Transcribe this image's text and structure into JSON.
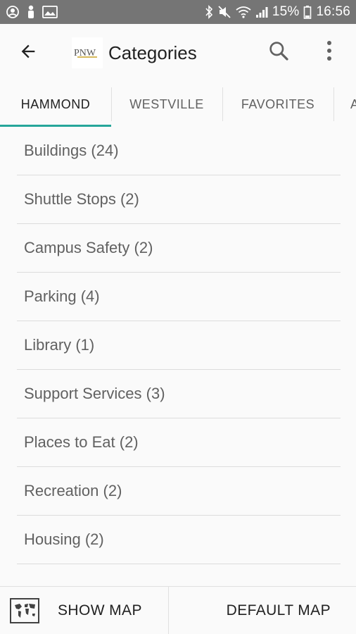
{
  "status_bar": {
    "battery": "15%",
    "time": "16:56"
  },
  "app_bar": {
    "logo_text": "PNW",
    "title": "Categories"
  },
  "tabs": [
    {
      "label": "HAMMOND",
      "active": true
    },
    {
      "label": "WESTVILLE",
      "active": false
    },
    {
      "label": "FAVORITES",
      "active": false
    },
    {
      "label": "A",
      "active": false
    }
  ],
  "categories": [
    {
      "label": "Buildings (24)"
    },
    {
      "label": "Shuttle Stops (2)"
    },
    {
      "label": "Campus Safety (2)"
    },
    {
      "label": "Parking (4)"
    },
    {
      "label": "Library (1)"
    },
    {
      "label": "Support Services (3)"
    },
    {
      "label": "Places to Eat (2)"
    },
    {
      "label": "Recreation (2)"
    },
    {
      "label": "Housing (2)"
    }
  ],
  "bottom_bar": {
    "show_map_label": "SHOW MAP",
    "default_map_label": "DEFAULT MAP"
  },
  "colors": {
    "accent": "#26a69a",
    "status_bar": "#757575",
    "logo_gold": "#c9a227"
  }
}
